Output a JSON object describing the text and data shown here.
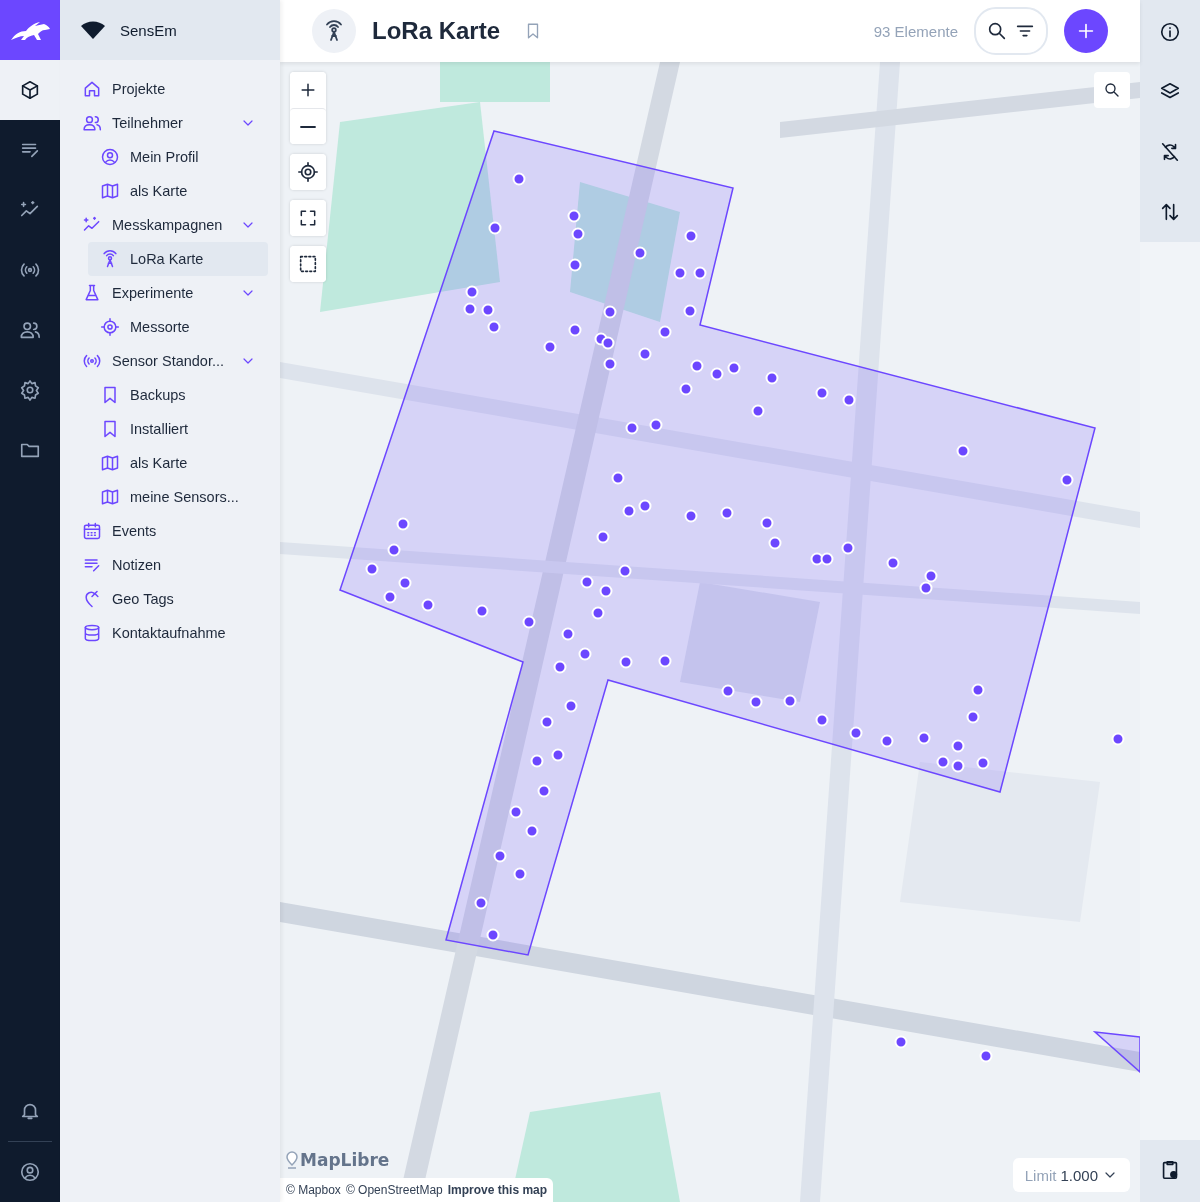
{
  "brand": {
    "workspace": "SensEm"
  },
  "rail": [
    {
      "selected": true
    },
    {
      "selected": false
    },
    {
      "selected": false
    },
    {
      "selected": false
    },
    {
      "selected": false
    },
    {
      "selected": false
    },
    {
      "selected": false
    }
  ],
  "rail_bottom": [
    {
      "selected": false
    },
    {
      "selected": false
    }
  ],
  "nav": [
    {
      "label": "Projekte",
      "selected": false
    },
    {
      "label": "Teilnehmer",
      "selected": false,
      "expanded": true,
      "children": [
        {
          "label": "Mein Profil",
          "selected": false
        },
        {
          "label": "als Karte",
          "selected": false
        }
      ]
    },
    {
      "label": "Messkampagnen",
      "selected": false,
      "expanded": true,
      "children": [
        {
          "label": "LoRa Karte",
          "selected": true
        }
      ]
    },
    {
      "label": "Experimente",
      "selected": false,
      "expanded": true,
      "children": [
        {
          "label": "Messorte",
          "selected": false
        }
      ]
    },
    {
      "label": "Sensor Standor...",
      "selected": false,
      "expanded": true,
      "children": [
        {
          "label": "Backups",
          "selected": false
        },
        {
          "label": "Installiert",
          "selected": false
        },
        {
          "label": "als Karte",
          "selected": false
        },
        {
          "label": "meine Sensors...",
          "selected": false
        }
      ]
    },
    {
      "label": "Events",
      "selected": false
    },
    {
      "label": "Notizen",
      "selected": false
    },
    {
      "label": "Geo Tags",
      "selected": false
    },
    {
      "label": "Kontaktaufnahme",
      "selected": false
    }
  ],
  "header": {
    "title": "LoRa Karte",
    "count": "93 Elemente"
  },
  "map": {
    "limit_label": "Limit",
    "limit_value": "1.000",
    "logo": "MapLibre",
    "attribution": [
      {
        "text": "© Mapbox",
        "kind": "plain"
      },
      {
        "text": "© OpenStreetMap",
        "kind": "plain"
      },
      {
        "text": "Improve this map",
        "kind": "link"
      }
    ]
  }
}
